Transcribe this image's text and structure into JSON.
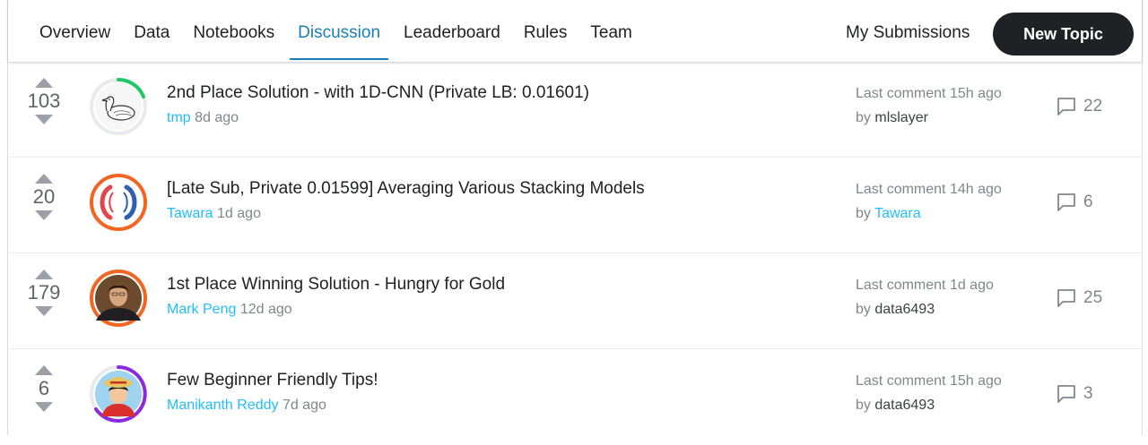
{
  "nav": {
    "tabs": [
      {
        "label": "Overview"
      },
      {
        "label": "Data"
      },
      {
        "label": "Notebooks"
      },
      {
        "label": "Discussion",
        "active": true
      },
      {
        "label": "Leaderboard"
      },
      {
        "label": "Rules"
      },
      {
        "label": "Team"
      }
    ],
    "my_submissions": "My Submissions",
    "new_topic": "New Topic"
  },
  "topics": [
    {
      "votes": "103",
      "title": "2nd Place Solution - with 1D-CNN (Private LB: 0.01601)",
      "author": "tmp",
      "posted": "8d ago",
      "last_comment_label": "Last comment",
      "last_comment_time": "15h ago",
      "by_label": "by",
      "last_by": "mlslayer",
      "comment_count": "22",
      "avatar_icon": "duck-sketch-avatar",
      "ring_color": "#1ec964",
      "ring_fraction": 0.22
    },
    {
      "votes": "20",
      "title": "[Late Sub, Private 0.01599] Averaging Various Stacking Models",
      "author": "Tawara",
      "posted": "1d ago",
      "last_comment_label": "Last comment",
      "last_comment_time": "14h ago",
      "by_label": "by",
      "last_by": "Tawara",
      "comment_count": "6",
      "avatar_icon": "logo-avatar",
      "ring_color": "#f26522",
      "ring_fraction": 1
    },
    {
      "votes": "179",
      "title": "1st Place Winning Solution - Hungry for Gold",
      "author": "Mark Peng",
      "posted": "12d ago",
      "last_comment_label": "Last comment",
      "last_comment_time": "1d ago",
      "by_label": "by",
      "last_by": "data6493",
      "comment_count": "25",
      "avatar_icon": "person-photo-avatar",
      "ring_color": "#f26522",
      "ring_fraction": 1
    },
    {
      "votes": "6",
      "title": "Few Beginner Friendly Tips!",
      "author": "Manikanth Reddy",
      "posted": "7d ago",
      "last_comment_label": "Last comment",
      "last_comment_time": "15h ago",
      "by_label": "by",
      "last_by": "data6493",
      "comment_count": "3",
      "avatar_icon": "anime-character-avatar",
      "ring_color": "#8a2be2",
      "ring_fraction": 0.72
    }
  ],
  "colors": {
    "accent": "#1a7fb8",
    "link": "#20beff",
    "button": "#202124"
  }
}
